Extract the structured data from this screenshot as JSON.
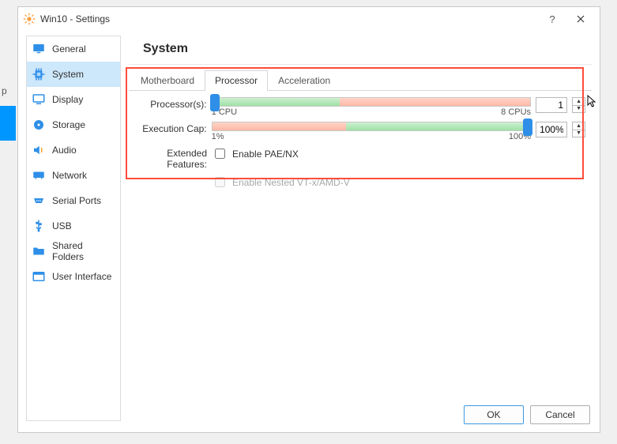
{
  "window": {
    "title": "Win10 - Settings"
  },
  "page": {
    "heading": "System"
  },
  "nav": [
    {
      "key": "general",
      "label": "General"
    },
    {
      "key": "system",
      "label": "System"
    },
    {
      "key": "display",
      "label": "Display"
    },
    {
      "key": "storage",
      "label": "Storage"
    },
    {
      "key": "audio",
      "label": "Audio"
    },
    {
      "key": "network",
      "label": "Network"
    },
    {
      "key": "serialports",
      "label": "Serial Ports"
    },
    {
      "key": "usb",
      "label": "USB"
    },
    {
      "key": "sharedfolders",
      "label": "Shared Folders"
    },
    {
      "key": "ui",
      "label": "User Interface"
    }
  ],
  "nav_selected": "system",
  "tabs": {
    "motherboard": "Motherboard",
    "processor": "Processor",
    "acceleration": "Acceleration"
  },
  "tab_active": "processor",
  "processor": {
    "processors_label": "Processor(s):",
    "processors_min": "1 CPU",
    "processors_max": "8 CPUs",
    "processors_value": "1",
    "execcap_label": "Execution Cap:",
    "execcap_min": "1%",
    "execcap_max": "100%",
    "execcap_value": "100%",
    "extended_label": "Extended Features:",
    "pae_label": "Enable PAE/NX",
    "pae_checked": false,
    "nested_label": "Enable Nested VT-x/AMD-V",
    "nested_checked": false,
    "nested_enabled": false
  },
  "buttons": {
    "ok": "OK",
    "cancel": "Cancel"
  },
  "behind_char": "p"
}
